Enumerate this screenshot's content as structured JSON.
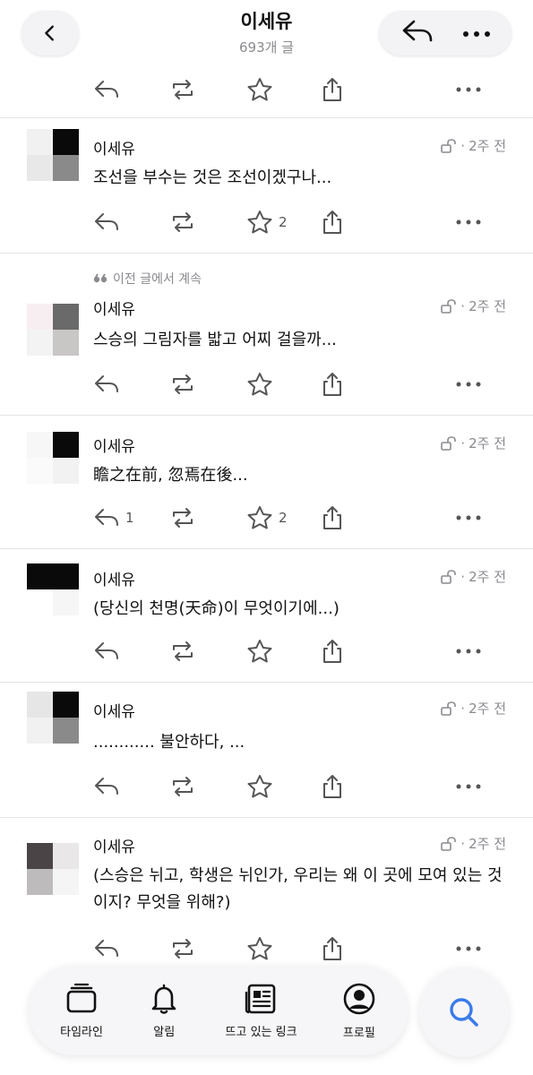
{
  "header": {
    "title": "이세유",
    "subtitle": "693개 글",
    "back_icon": "chevron-left-icon",
    "reply_icon": "reply-icon",
    "more_icon": "more-icon"
  },
  "posts": [
    {
      "author": "이세유",
      "time": "2주 전",
      "text": "조선을 부수는 것은 조선이겠구나...",
      "reply_count": "",
      "fav_count": "2",
      "context": ""
    },
    {
      "author": "이세유",
      "time": "2주 전",
      "text": "스승의 그림자를 밟고 어찌 걸을까...",
      "reply_count": "",
      "fav_count": "",
      "context": "이전 글에서 계속"
    },
    {
      "author": "이세유",
      "time": "2주 전",
      "text": "瞻之在前, 忽焉在後...",
      "reply_count": "1",
      "fav_count": "2",
      "context": ""
    },
    {
      "author": "이세유",
      "time": "2주 전",
      "text": "(당신의 천명(天命)이 무엇이기에...)",
      "reply_count": "",
      "fav_count": "",
      "context": ""
    },
    {
      "author": "이세유",
      "time": "2주 전",
      "text": "............ 불안하다, ...",
      "reply_count": "",
      "fav_count": "",
      "context": ""
    },
    {
      "author": "이세유",
      "time": "2주 전",
      "text": "(스승은 뉘고, 학생은 뉘인가, 우리는 왜 이 곳에 모여 있는 것이지? 무엇을 위해?)",
      "reply_count": "",
      "fav_count": "",
      "context": ""
    }
  ],
  "meta_separator": "·",
  "nav": {
    "timeline": "타임라인",
    "alerts": "알림",
    "trending": "뜨고 있는 링크",
    "profile": "프로필"
  },
  "colors": {
    "accent": "#3a7bea",
    "muted": "#8a8a8f",
    "icon": "#555555"
  }
}
